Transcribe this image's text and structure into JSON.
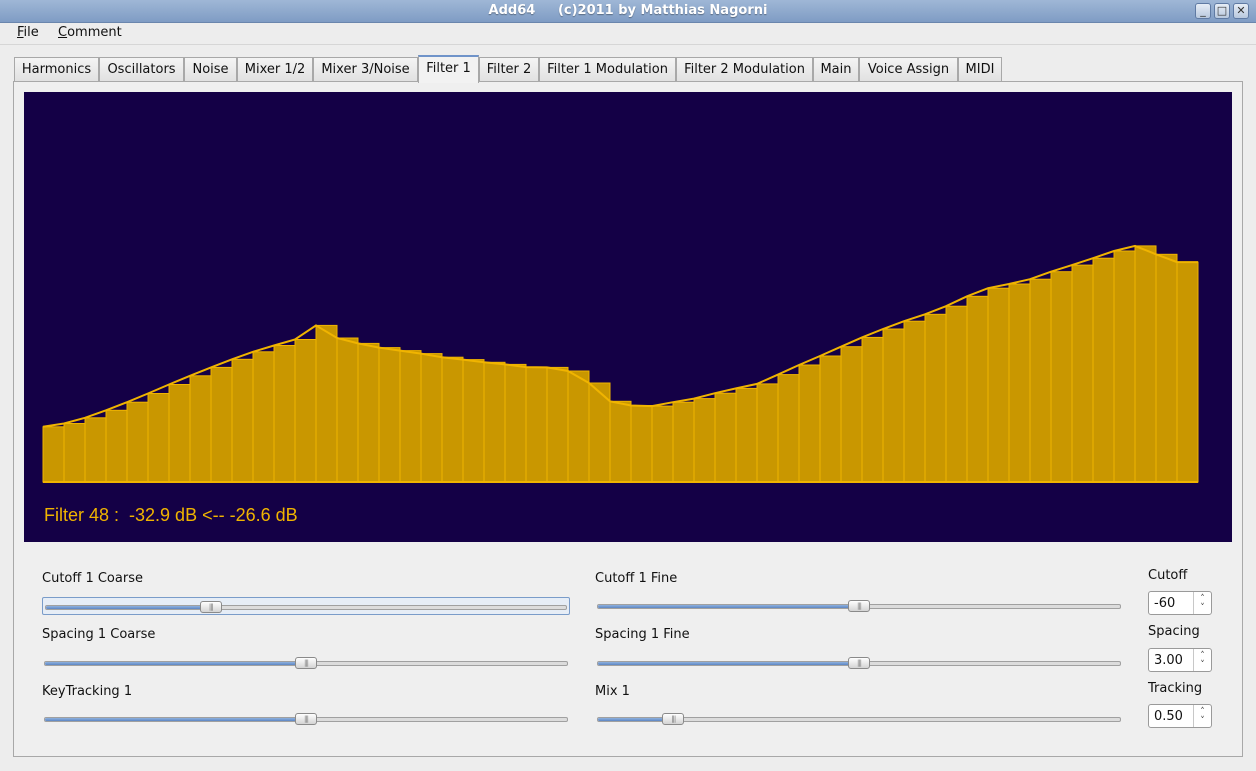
{
  "window": {
    "title": "Add64     (c)2011 by Matthias Nagorni",
    "minimize_glyph": "_",
    "maximize_glyph": "□",
    "close_glyph": "✕"
  },
  "menu": {
    "file": {
      "accel": "F",
      "rest": "ile"
    },
    "comment": {
      "accel": "C",
      "rest": "omment"
    }
  },
  "tabs": [
    "Harmonics",
    "Oscillators",
    "Noise",
    "Mixer 1/2",
    "Mixer 3/Noise",
    "Filter 1",
    "Filter 2",
    "Filter 1 Modulation",
    "Filter 2 Modulation",
    "Main",
    "Voice Assign",
    "MIDI"
  ],
  "active_tab": "Filter 1",
  "display": {
    "background_color": "#140046",
    "bar_color": "#c99700",
    "line_color": "#f0b400",
    "readout": "Filter 48 :  -32.9 dB <-- -26.6 dB",
    "filter_levels": [
      0.184,
      0.195,
      0.214,
      0.239,
      0.266,
      0.295,
      0.325,
      0.354,
      0.382,
      0.409,
      0.434,
      0.455,
      0.475,
      0.522,
      0.48,
      0.462,
      0.448,
      0.438,
      0.428,
      0.416,
      0.408,
      0.399,
      0.392,
      0.383,
      0.382,
      0.37,
      0.33,
      0.269,
      0.255,
      0.253,
      0.266,
      0.278,
      0.296,
      0.312,
      0.327,
      0.358,
      0.39,
      0.42,
      0.451,
      0.482,
      0.51,
      0.536,
      0.559,
      0.586,
      0.619,
      0.646,
      0.66,
      0.676,
      0.701,
      0.723,
      0.746,
      0.77,
      0.787,
      0.759,
      0.733
    ]
  },
  "controls": {
    "cutoff_coarse": {
      "label": "Cutoff 1 Coarse",
      "value": 0.31
    },
    "cutoff_fine": {
      "label": "Cutoff 1 Fine",
      "value": 0.5
    },
    "spacing_coarse": {
      "label": "Spacing 1 Coarse",
      "value": 0.5
    },
    "spacing_fine": {
      "label": "Spacing 1 Fine",
      "value": 0.5
    },
    "keytracking": {
      "label": "KeyTracking 1",
      "value": 0.5
    },
    "mix": {
      "label": "Mix 1",
      "value": 0.13
    }
  },
  "spinboxes": {
    "cutoff": {
      "label": "Cutoff",
      "value": "-60"
    },
    "spacing": {
      "label": "Spacing",
      "value": "3.00"
    },
    "tracking": {
      "label": "Tracking",
      "value": "0.50"
    }
  },
  "spin_arrows": "˄\n˅",
  "handle_grip": "|||"
}
